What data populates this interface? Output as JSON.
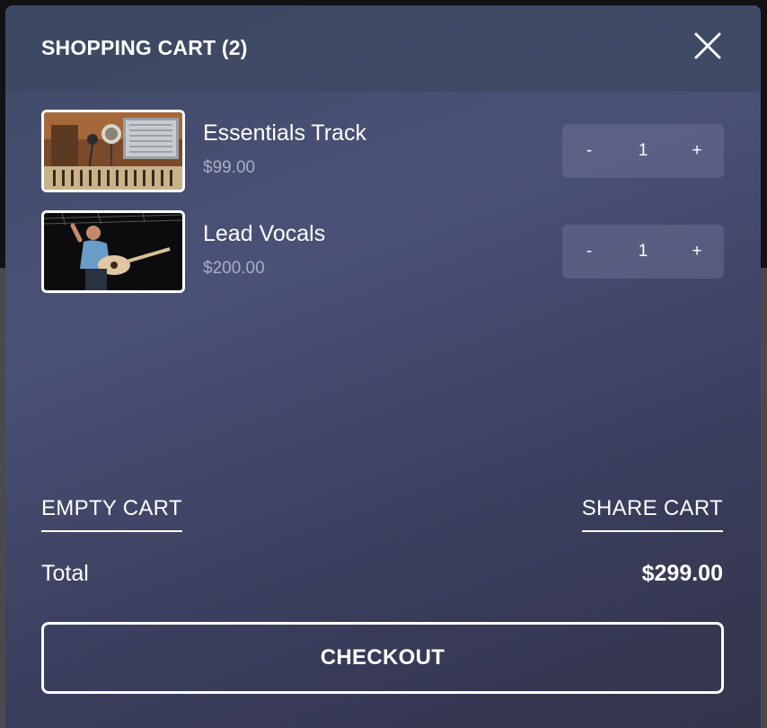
{
  "cart": {
    "title": "SHOPPING CART",
    "count_label": "(2)",
    "close_icon": "close-icon",
    "items": [
      {
        "name": "Essentials Track",
        "price": "$99.00",
        "qty_minus": "-",
        "quantity": "1",
        "qty_plus": "+",
        "thumbnail": "recording-studio-image"
      },
      {
        "name": "Lead Vocals",
        "price": "$200.00",
        "qty_minus": "-",
        "quantity": "1",
        "qty_plus": "+",
        "thumbnail": "singer-guitar-image"
      }
    ],
    "empty_label": "EMPTY CART",
    "share_label": "SHARE CART",
    "total_label": "Total",
    "total_value": "$299.00",
    "checkout_label": "CHECKOUT"
  }
}
